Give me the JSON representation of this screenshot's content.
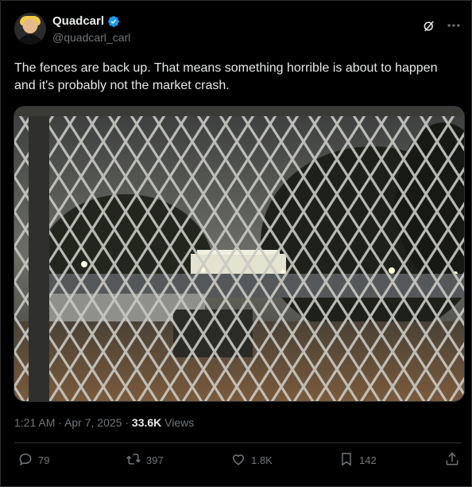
{
  "author": {
    "display_name": "Quadcarl",
    "handle": "@quadcarl_carl",
    "verified": true
  },
  "tweet": {
    "text": "The fences are back up. That means something horrible is about to happen and it's probably not the market crash.",
    "time": "1:21 AM",
    "separator": "·",
    "date": "Apr 7, 2025",
    "views_count": "33.6K",
    "views_label": "Views"
  },
  "media": {
    "description_icon": "photo-fence-white-house-night"
  },
  "actions": {
    "replies": "79",
    "reposts": "397",
    "likes": "1.8K",
    "bookmarks": "142"
  },
  "colors": {
    "background": "#000000",
    "text": "#e7e9ea",
    "muted": "#71767b",
    "verified": "#1d9bf0",
    "border": "#2f3336"
  },
  "icons": {
    "verified": "verified-badge-icon",
    "grok": "grok-icon",
    "more": "more-icon",
    "reply": "reply-icon",
    "repost": "repost-icon",
    "like": "like-icon",
    "bookmark": "bookmark-icon",
    "share": "share-icon"
  }
}
